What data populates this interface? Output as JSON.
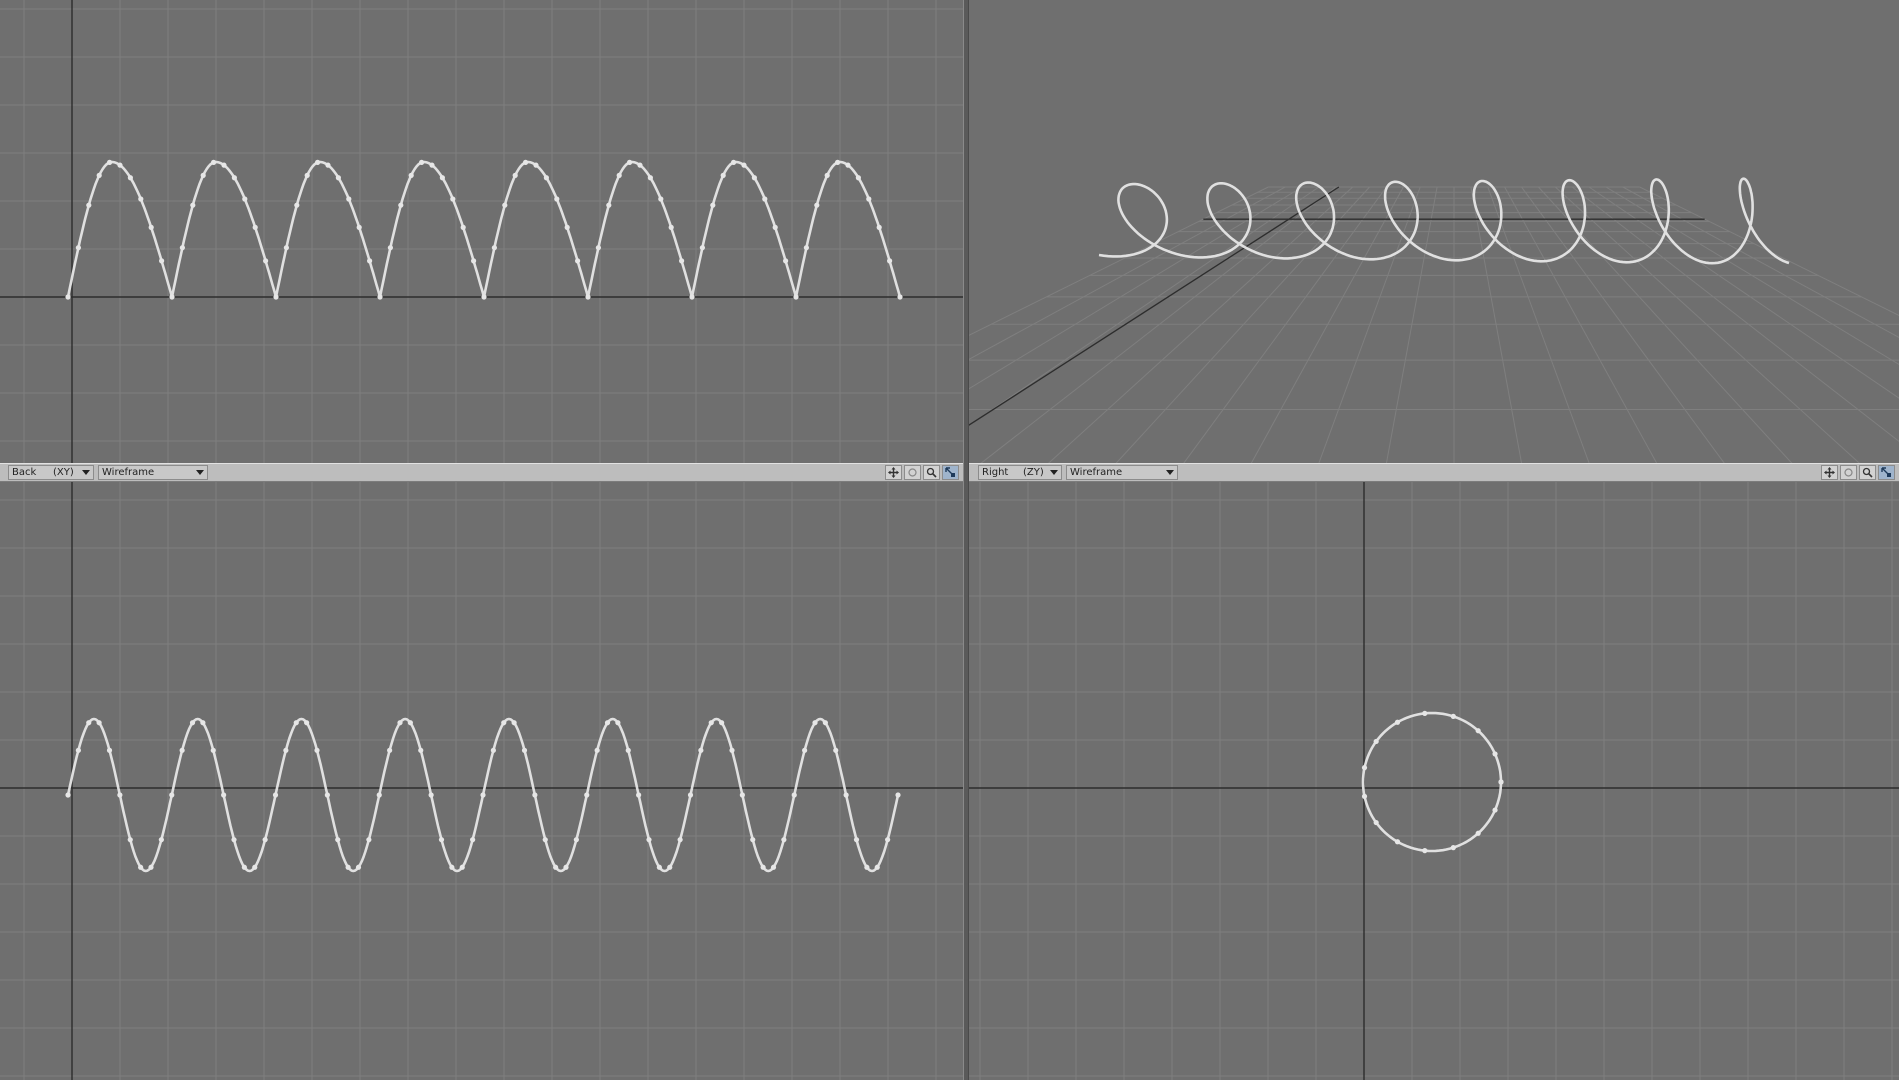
{
  "viewports": {
    "top_left": {},
    "top_right": {},
    "bottom_left": {
      "view_label": "Back",
      "axes_label": "(XY)",
      "shading_label": "Wireframe"
    },
    "bottom_right": {
      "view_label": "Right",
      "axes_label": "(ZY)",
      "shading_label": "Wireframe"
    }
  },
  "toolbar_icons": [
    "move-view-icon",
    "rotate-view-icon",
    "zoom-view-icon",
    "maximize-view-icon"
  ],
  "colors": {
    "background": "#6f6f6f",
    "grid": "#7f7f7f",
    "axis": "#2d2d2d",
    "curve": "#e6e6e6",
    "header_bar": "#bdbdbd",
    "active_tool": "#9fb4cc"
  },
  "curve": {
    "cycles": 8
  }
}
